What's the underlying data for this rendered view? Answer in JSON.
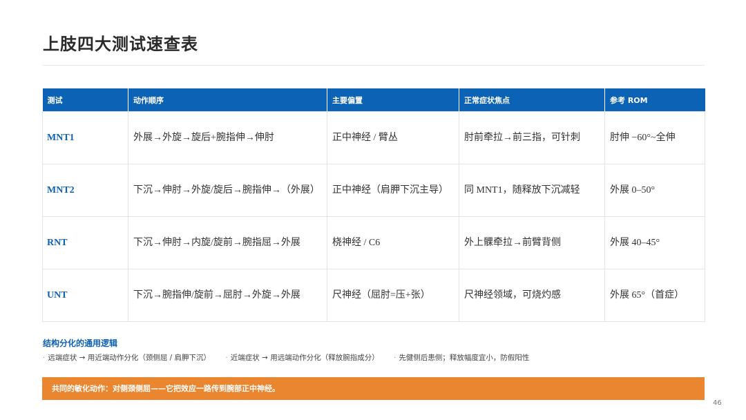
{
  "title": "上肢四大测试速查表",
  "table": {
    "headers": [
      "测试",
      "动作顺序",
      "主要偏置",
      "正常症状焦点",
      "参考 ROM"
    ],
    "rows": [
      [
        "MNT1",
        "外展→外旋→旋后+腕指伸→伸肘",
        "正中神经 / 臂丛",
        "肘前牵拉→前三指，可针刺",
        "肘伸 −60°~全伸"
      ],
      [
        "MNT2",
        "下沉→伸肘→外旋/旋后→腕指伸→（外展）",
        "正中神经（肩胛下沉主导）",
        "同 MNT1，随释放下沉减轻",
        "外展 0–50°"
      ],
      [
        "RNT",
        "下沉→伸肘→内旋/旋前→腕指屈→外展",
        "桡神经 / C6",
        "外上髁牵拉→前臂背侧",
        "外展 40–45°"
      ],
      [
        "UNT",
        "下沉→腕指伸/旋前→屈肘→外旋→外展",
        "尺神经（屈肘=压+张）",
        "尺神经领域，可烧灼感",
        "外展 65°（首症）"
      ]
    ]
  },
  "logic": {
    "title": "结构分化的通用逻辑",
    "points": [
      "远端症状 → 用近端动作分化（颈侧屈 / 肩胛下沉）",
      "近端症状 → 用远端动作分化（释放腕指成分）",
      "先健侧后患侧；释放幅度宜小，防假阳性"
    ]
  },
  "banner": "共同的敏化动作：对侧颈侧屈——它把效应一路传到腕部正中神经。",
  "page_number": "46",
  "colors": {
    "accent_blue": "#0c62b4",
    "accent_orange": "#ea8530"
  }
}
